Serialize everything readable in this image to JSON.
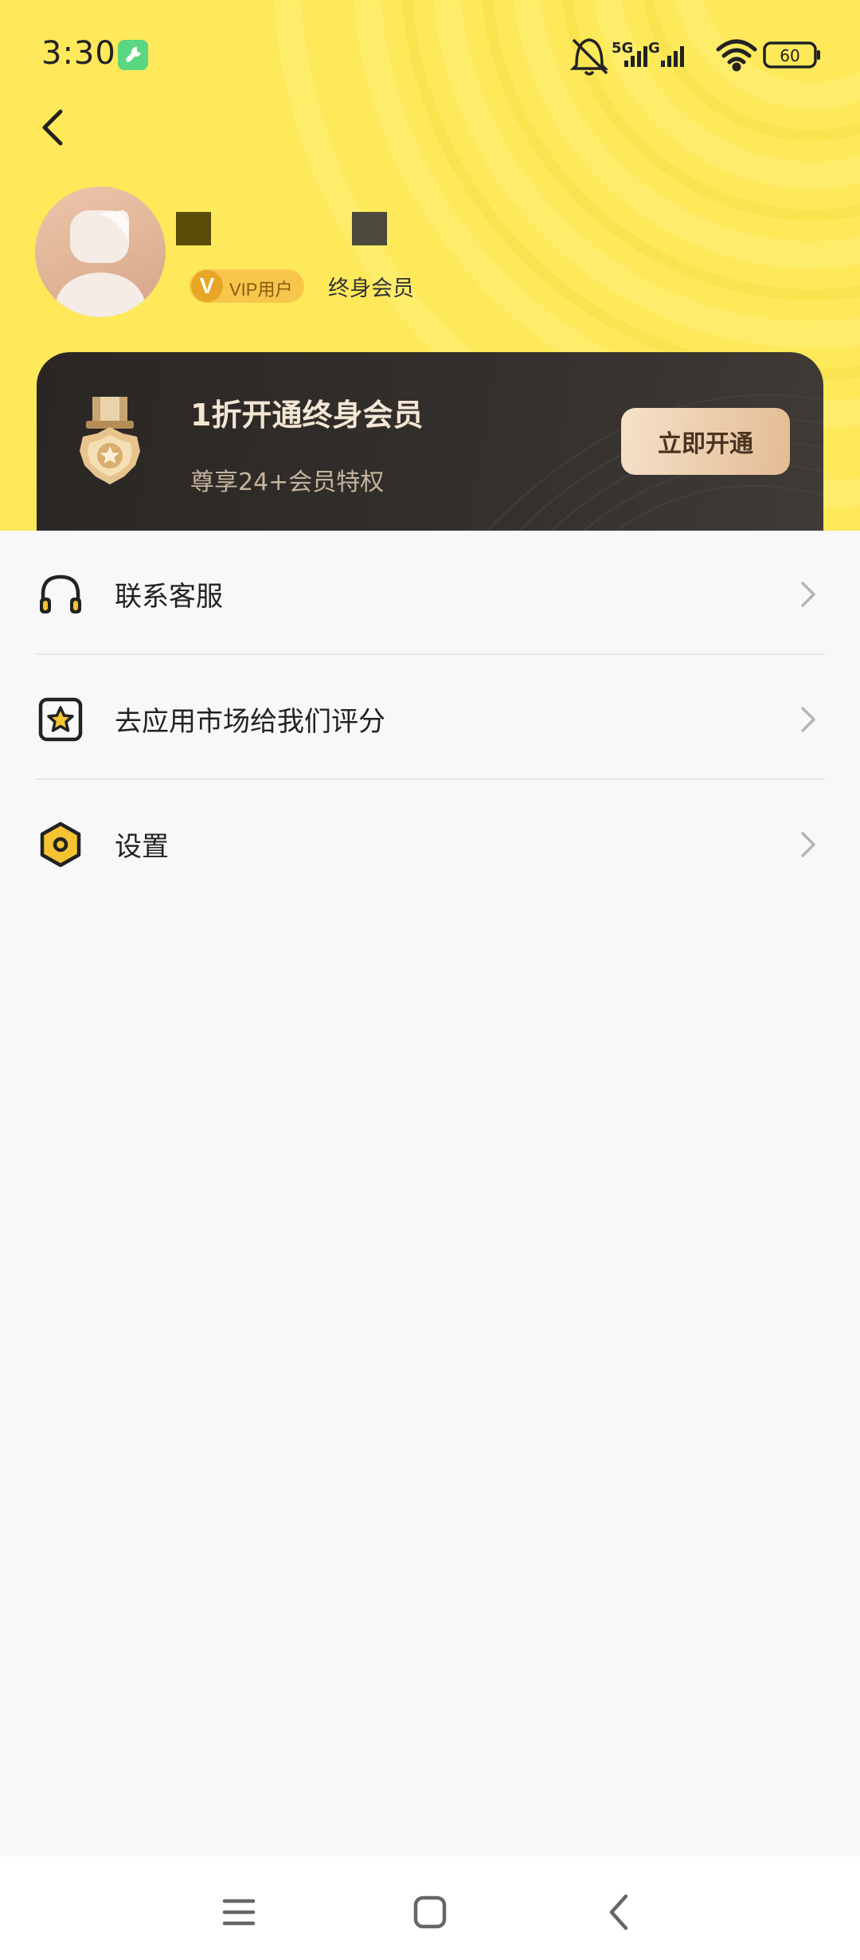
{
  "status_bar": {
    "time": "3:30",
    "app_icon": "wrench-icon",
    "indicators": [
      "bell-muted-icon",
      "signal-5g-icon",
      "signal-g-icon",
      "wifi-icon",
      "battery-icon"
    ],
    "network_5g_label": "5G",
    "network_g_label": "G",
    "battery_level": "60"
  },
  "header": {
    "back_icon": "chevron-left-icon",
    "background_color": "#fde95a"
  },
  "profile": {
    "avatar_icon": "default-avatar-icon",
    "vip_badge": {
      "letter": "V",
      "label": "VIP用户"
    },
    "member_type": "终身会员"
  },
  "vip_card": {
    "icon": "medal-icon",
    "title": "1折开通终身会员",
    "subtitle": "尊享24+会员特权",
    "button_label": "立即开通"
  },
  "menu": {
    "items": [
      {
        "icon": "headset-icon",
        "label": "联系客服"
      },
      {
        "icon": "star-rating-icon",
        "label": "去应用市场给我们评分"
      },
      {
        "icon": "settings-hexagon-icon",
        "label": "设置"
      }
    ]
  },
  "nav_bar": {
    "buttons": [
      "menu-icon",
      "home-icon",
      "back-icon"
    ]
  }
}
